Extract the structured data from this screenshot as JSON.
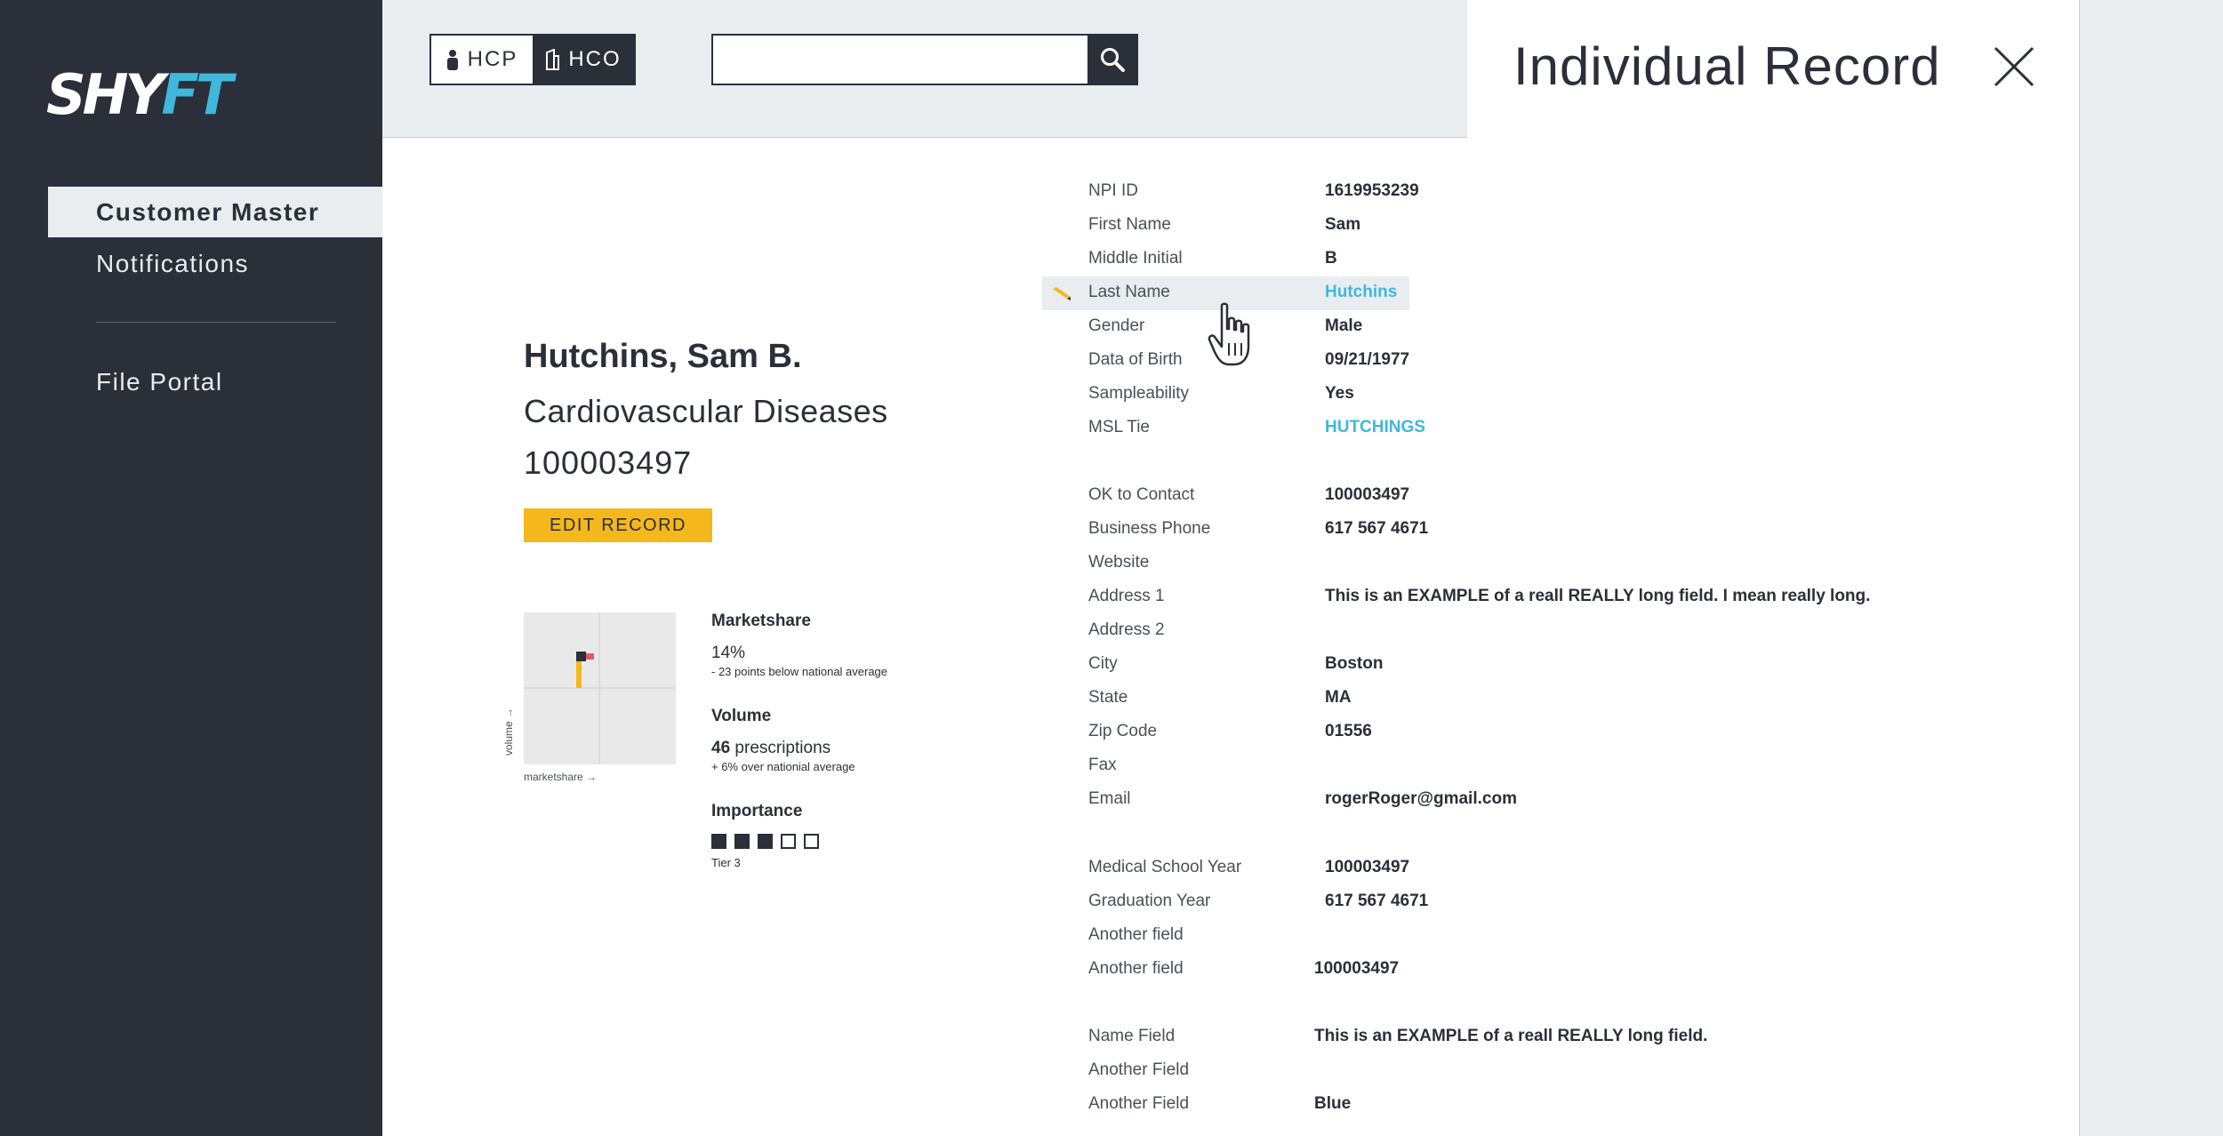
{
  "sidebar": {
    "logo": {
      "part1": "SHY",
      "part2": "FT"
    },
    "items": [
      {
        "label": "Customer Master"
      },
      {
        "label": "Notifications"
      },
      {
        "label": "File Portal"
      }
    ]
  },
  "topbar": {
    "toggle": {
      "hcp": "HCP",
      "hco": "HCO"
    },
    "search": {
      "placeholder": "",
      "value": ""
    }
  },
  "panel": {
    "title": "Individual Record"
  },
  "profile": {
    "name": "Hutchins, Sam B.",
    "specialty": "Cardiovascular Diseases",
    "id": "100003497",
    "edit_label": "EDIT RECORD"
  },
  "mini_chart": {
    "xlabel": "marketshare →",
    "ylabel": "volume →",
    "colors": {
      "marker": "#2b2f3a",
      "share": "#e05a6b",
      "volume": "#f5b81c"
    }
  },
  "metrics": {
    "marketshare": {
      "label": "Marketshare",
      "value": "14%",
      "note": "- 23 points below national average",
      "fraction": 0.14
    },
    "volume": {
      "label": "Volume",
      "value_num": "46",
      "value_unit": "prescriptions",
      "note": "+ 6% over nationial average"
    },
    "importance": {
      "label": "Importance",
      "filled": 3,
      "total": 5,
      "tier": "Tier 3"
    }
  },
  "fields": [
    {
      "label": "NPI ID",
      "value": "1619953239"
    },
    {
      "label": "First Name",
      "value": "Sam"
    },
    {
      "label": "Middle Initial",
      "value": "B"
    },
    {
      "label": "Last Name",
      "value": "Hutchins",
      "link": true,
      "hover": true
    },
    {
      "label": "Gender",
      "value": "Male"
    },
    {
      "label": "Data of Birth",
      "value": "09/21/1977"
    },
    {
      "label": "Sampleability",
      "value": "Yes"
    },
    {
      "label": "MSL Tie",
      "value": "HUTCHINGS",
      "link": true
    },
    {
      "label": "OK to Contact",
      "value": "100003497"
    },
    {
      "label": "Business Phone",
      "value": "617 567 4671"
    },
    {
      "label": "Website",
      "value": ""
    },
    {
      "label": "Address 1",
      "value": "This is an EXAMPLE of a reall REALLY long field. I mean really long."
    },
    {
      "label": "Address 2",
      "value": ""
    },
    {
      "label": "City",
      "value": "Boston"
    },
    {
      "label": "State",
      "value": "MA"
    },
    {
      "label": "Zip Code",
      "value": "01556"
    },
    {
      "label": "Fax",
      "value": ""
    },
    {
      "label": "Email",
      "value": "rogerRoger@gmail.com"
    },
    {
      "label": "Medical School Year",
      "value": "100003497"
    },
    {
      "label": "Graduation Year",
      "value": "617 567 4671"
    },
    {
      "label": "Another field",
      "value": ""
    },
    {
      "label": "Another field",
      "value": "100003497"
    },
    {
      "label": "Name Field",
      "value": "This is an EXAMPLE of a reall REALLY long field."
    },
    {
      "label": "Another Field",
      "value": ""
    },
    {
      "label": "Another Field",
      "value": "Blue"
    }
  ]
}
